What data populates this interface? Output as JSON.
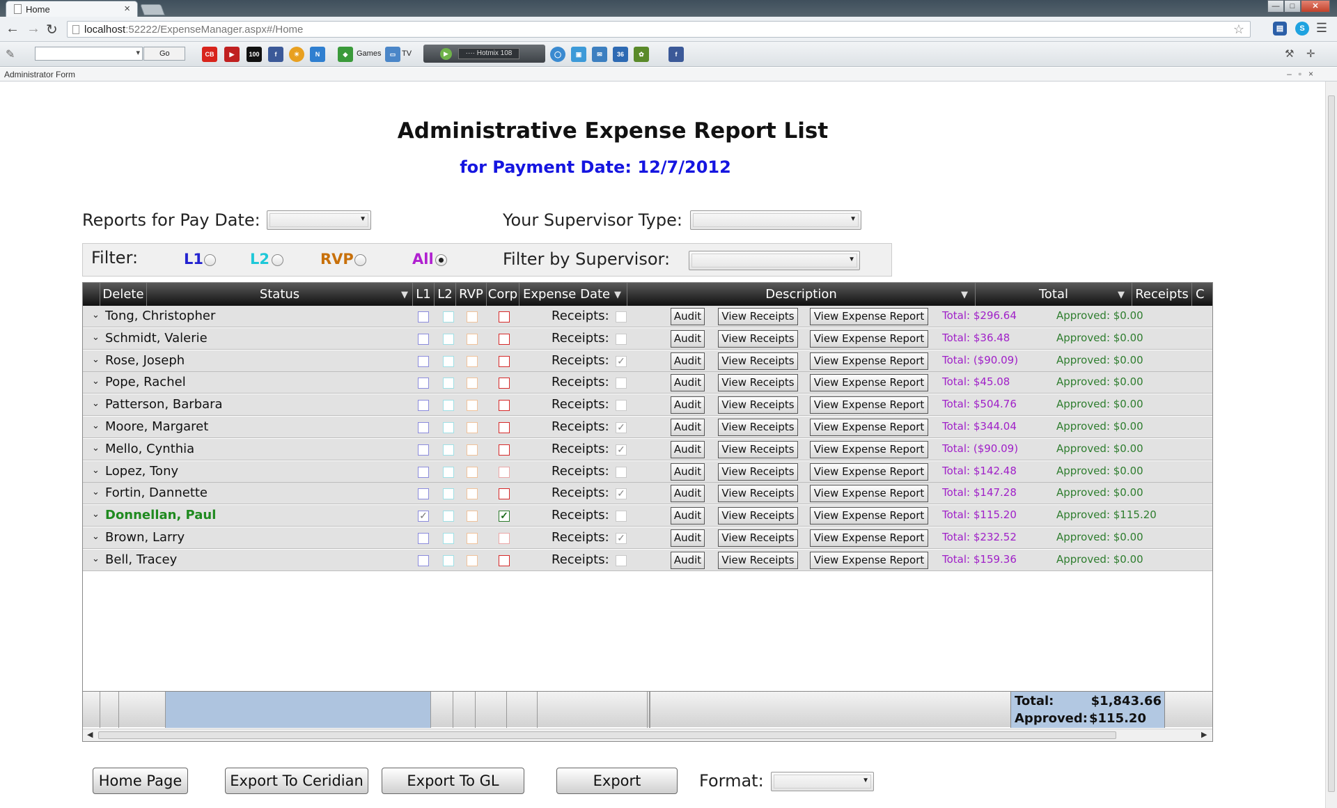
{
  "browser": {
    "tab_title": "Home",
    "tab_close": "×",
    "url_host": "localhost",
    "url_rest": ":52222/ExpenseManager.aspx#/Home",
    "toolbar_go": "Go",
    "toolbar_games": "Games",
    "toolbar_tv": "TV",
    "radio_station": "···· Hotmix 108",
    "icons": [
      "back-icon",
      "forward-icon",
      "reload-icon",
      "star-icon",
      "wrench-icon"
    ]
  },
  "window": {
    "title": "Administrator Form"
  },
  "page": {
    "title": "Administrative Expense Report List",
    "subtitle": "for Payment Date: 12/7/2012",
    "pay_date_label": "Reports for Pay Date:",
    "pay_date_value": "",
    "supervisor_type_label": "Your Supervisor Type:",
    "supervisor_type_value": "",
    "filter_label": "Filter:",
    "filter_options": [
      {
        "label": "L1",
        "color": "#2323d0",
        "checked": false
      },
      {
        "label": "L2",
        "color": "#1ec8d8",
        "checked": false
      },
      {
        "label": "RVP",
        "color": "#c8700a",
        "checked": false
      },
      {
        "label": "All",
        "color": "#b020d0",
        "checked": true
      }
    ],
    "filter_supervisor_label": "Filter by Supervisor:",
    "filter_supervisor_value": ""
  },
  "grid": {
    "columns": [
      "Delete",
      "Status",
      "L1",
      "L2",
      "RVP",
      "Corp",
      "Expense Date",
      "Description",
      "Total",
      "Receipts",
      "C"
    ],
    "receipts_label": "Receipts:",
    "audit_label": "Audit",
    "view_receipts_label": "View Receipts",
    "view_report_label": "View Expense Report",
    "rows": [
      {
        "name": "Tong, Christopher",
        "l1": false,
        "corp": "red",
        "receipts": false,
        "total": "Total: $296.64",
        "approved": "Approved: $0.00"
      },
      {
        "name": "Schmidt, Valerie",
        "l1": false,
        "corp": "red",
        "receipts": false,
        "total": "Total: $36.48",
        "approved": "Approved: $0.00"
      },
      {
        "name": "Rose, Joseph",
        "l1": false,
        "corp": "red",
        "receipts": true,
        "total": "Total: ($90.09)",
        "approved": "Approved: $0.00"
      },
      {
        "name": "Pope, Rachel",
        "l1": false,
        "corp": "red",
        "receipts": false,
        "total": "Total: $45.08",
        "approved": "Approved: $0.00"
      },
      {
        "name": "Patterson, Barbara",
        "l1": false,
        "corp": "red",
        "receipts": false,
        "total": "Total: $504.76",
        "approved": "Approved: $0.00"
      },
      {
        "name": "Moore, Margaret",
        "l1": false,
        "corp": "red",
        "receipts": true,
        "total": "Total: $344.04",
        "approved": "Approved: $0.00"
      },
      {
        "name": "Mello, Cynthia",
        "l1": false,
        "corp": "red",
        "receipts": true,
        "total": "Total: ($90.09)",
        "approved": "Approved: $0.00"
      },
      {
        "name": "Lopez, Tony",
        "l1": false,
        "corp": "faded",
        "receipts": false,
        "total": "Total: $142.48",
        "approved": "Approved: $0.00"
      },
      {
        "name": "Fortin, Dannette",
        "l1": false,
        "corp": "red",
        "receipts": true,
        "total": "Total: $147.28",
        "approved": "Approved: $0.00"
      },
      {
        "name": "Donnellan, Paul",
        "l1": true,
        "corp": "checked",
        "receipts": false,
        "total": "Total: $115.20",
        "approved": "Approved: $115.20",
        "highlight": true
      },
      {
        "name": "Brown, Larry",
        "l1": false,
        "corp": "faded",
        "receipts": true,
        "total": "Total: $232.52",
        "approved": "Approved: $0.00"
      },
      {
        "name": "Bell, Tracey",
        "l1": false,
        "corp": "red",
        "receipts": false,
        "total": "Total: $159.36",
        "approved": "Approved: $0.00"
      }
    ],
    "footer_total_label": "Total:",
    "footer_total_value": "$1,843.66",
    "footer_approved_label": "Approved:",
    "footer_approved_value": "$115.20"
  },
  "buttons": {
    "home": "Home Page",
    "export_ceridian": "Export To Ceridian",
    "export_gl": "Export To GL",
    "export": "Export",
    "format_label": "Format:",
    "format_value": ""
  }
}
